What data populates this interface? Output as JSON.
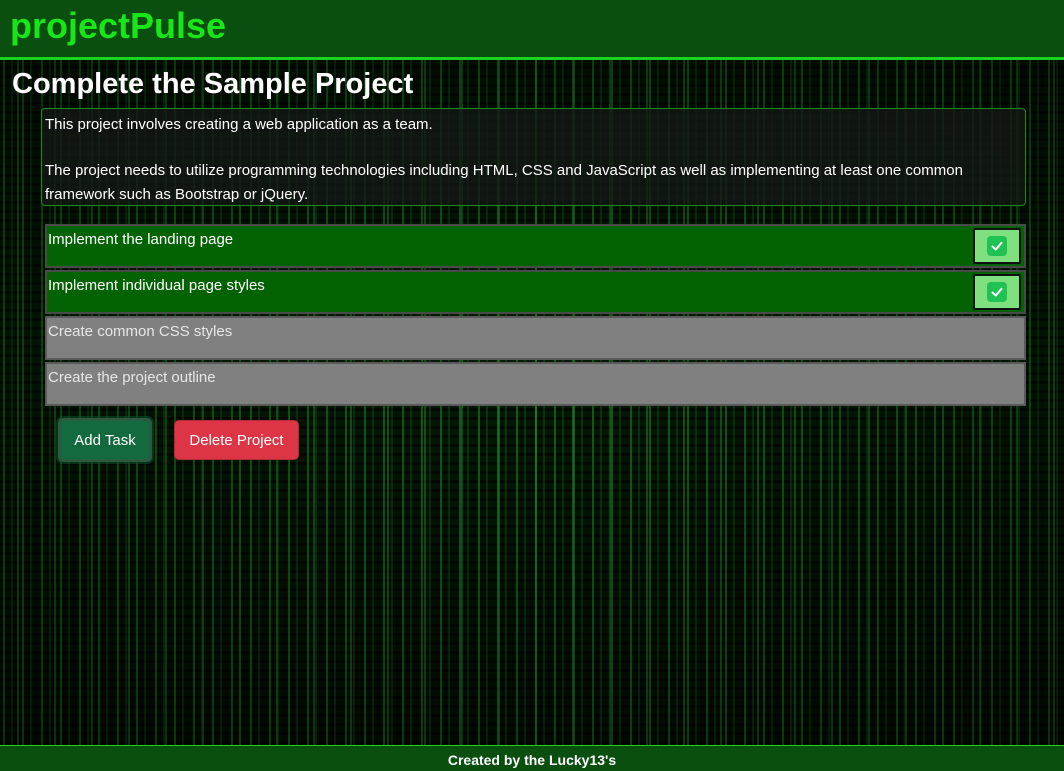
{
  "header": {
    "brand": "projectPulse"
  },
  "project": {
    "title": "Complete the Sample Project",
    "description": [
      "This project involves creating a web application as a team.",
      "The project needs to utilize programming technologies including HTML, CSS and JavaScript as well as implementing at least one common framework such as Bootstrap or jQuery."
    ]
  },
  "tasks": [
    {
      "label": "Implement the landing page",
      "completed": true,
      "status_icon": "check-icon"
    },
    {
      "label": "Implement individual page styles",
      "completed": true,
      "status_icon": "check-icon"
    },
    {
      "label": "Create common CSS styles",
      "completed": false
    },
    {
      "label": "Create the project outline",
      "completed": false
    }
  ],
  "actions": {
    "add_task_label": "Add Task",
    "delete_project_label": "Delete Project"
  },
  "footer": {
    "text": "Created by the Lucky13's"
  },
  "colors": {
    "brand_green": "#19e619",
    "header_bg": "#0a4f0f",
    "task_done_bg": "#036303",
    "task_todo_bg": "#808080",
    "add_button_bg": "#136a3e",
    "delete_button_bg": "#dc3545"
  }
}
